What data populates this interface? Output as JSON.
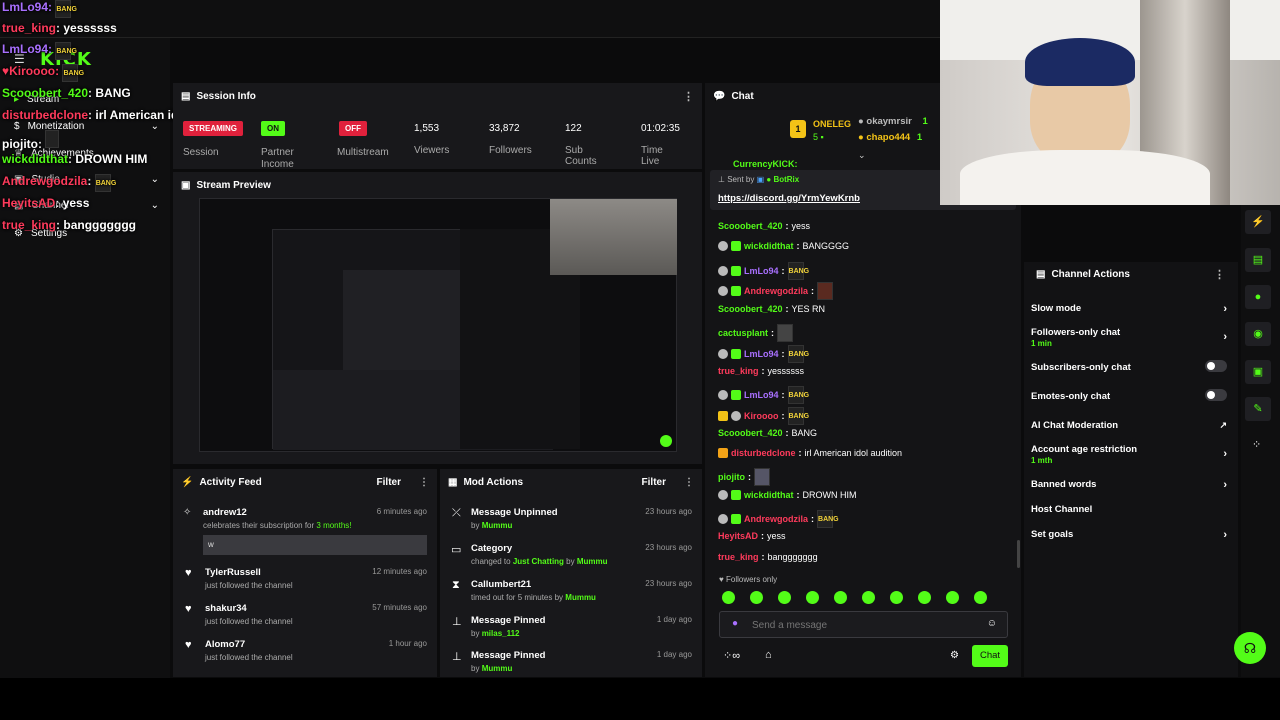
{
  "sidebar": {
    "items": [
      {
        "label": "Stream"
      },
      {
        "label": "Monetization"
      },
      {
        "label": "Achievements"
      },
      {
        "label": "Studio"
      },
      {
        "label": "Channel"
      },
      {
        "label": "Settings"
      }
    ]
  },
  "logo": "KICK",
  "overlay_chat": [
    {
      "user": "LmLo94",
      "msg": "",
      "color": "#a970ff"
    },
    {
      "user": "true_king",
      "msg": "yessssss",
      "color": "#ff3b5c"
    },
    {
      "user": "LmLo94",
      "msg": "",
      "color": "#a970ff"
    },
    {
      "user": "Kiroooo",
      "msg": "",
      "color": "#ff3b5c"
    },
    {
      "user": "Scooobert_420",
      "msg": "BANG",
      "color": "#53fc18"
    },
    {
      "user": "disturbedclone",
      "msg": "irl American idol audition",
      "color": "#ff3b5c"
    },
    {
      "user": "piojito",
      "msg": "",
      "color": "#ffffff"
    },
    {
      "user": "wickdidthat",
      "msg": "DROWN HIM",
      "color": "#53fc18"
    },
    {
      "user": "Andrewgodzila",
      "msg": "",
      "color": "#ff3b5c"
    },
    {
      "user": "HeyitsAD",
      "msg": "yess",
      "color": "#ff3b5c"
    },
    {
      "user": "true_king",
      "msg": "banggggggg",
      "color": "#ff3b5c"
    }
  ],
  "session": {
    "title": "Session Info",
    "streaming": "STREAMING",
    "on": "ON",
    "off": "OFF",
    "labels": {
      "session": "Session",
      "partner": "Partner Income",
      "multistream": "Multistream"
    },
    "stats": [
      {
        "value": "1,553",
        "label": "Viewers"
      },
      {
        "value": "33,872",
        "label": "Followers"
      },
      {
        "value": "122",
        "label": "Sub Counts"
      },
      {
        "value": "01:02:35",
        "label": "Time Live"
      }
    ]
  },
  "preview": {
    "title": "Stream Preview"
  },
  "activity": {
    "title": "Activity Feed",
    "filter": "Filter",
    "items": [
      {
        "user": "andrew12",
        "sub_prefix": "celebrates their subscription for ",
        "sub_count": "3 months!",
        "time": "6 minutes ago",
        "msg": "w"
      },
      {
        "user": "TylerRussell",
        "sub": "just followed the channel",
        "time": "12 minutes ago"
      },
      {
        "user": "shakur34",
        "sub": "just followed the channel",
        "time": "57 minutes ago"
      },
      {
        "user": "Alomo77",
        "sub": "just followed the channel",
        "time": "1 hour ago"
      }
    ]
  },
  "mod": {
    "title": "Mod Actions",
    "filter": "Filter",
    "items": [
      {
        "title": "Message Unpinned",
        "sub": "by",
        "who": "Mummu",
        "time": "23 hours ago"
      },
      {
        "title": "Category",
        "sub": "changed to",
        "cat": "Just Chatting",
        "by": "by",
        "who": "Mummu",
        "time": "23 hours ago"
      },
      {
        "title": "Callumbert21",
        "sub": "timed out for 5 minutes by",
        "who": "Mummu",
        "time": "23 hours ago"
      },
      {
        "title": "Message Pinned",
        "sub": "by",
        "who": "milas_112",
        "time": "1 day ago"
      },
      {
        "title": "Message Pinned",
        "sub": "by",
        "who": "Mummu",
        "time": "1 day ago"
      }
    ]
  },
  "chat": {
    "title": "Chat",
    "top_gifter": "ONELEG",
    "top_count": "5",
    "gifters": [
      {
        "name": "okaymrsir",
        "n": "1"
      },
      {
        "name": "chapo444",
        "n": "1"
      }
    ],
    "prev_user": "CurrencyKICK:",
    "pinned": {
      "sent_by": "Sent by",
      "bot": "BotRix",
      "link": "https://discord.gg/YrmYewKrnb"
    },
    "messages": [
      {
        "user": "Scooobert_420",
        "msg": "yess",
        "color": "#53fc18"
      },
      {
        "user": "wickdidthat",
        "msg": "BANGGGG",
        "color": "#53fc18"
      },
      {
        "user": "LmLo94",
        "msg": "",
        "color": "#a970ff"
      },
      {
        "user": "Andrewgodzila",
        "msg": "",
        "color": "#ff3b5c"
      },
      {
        "user": "Scooobert_420",
        "msg": "YES RN",
        "color": "#53fc18"
      },
      {
        "user": "cactusplant",
        "msg": "",
        "color": "#53fc18"
      },
      {
        "user": "LmLo94",
        "msg": "",
        "color": "#a970ff"
      },
      {
        "user": "true_king",
        "msg": "yessssss",
        "color": "#ff3b5c"
      },
      {
        "user": "LmLo94",
        "msg": "",
        "color": "#a970ff"
      },
      {
        "user": "Kiroooo",
        "msg": "",
        "color": "#ff3b5c"
      },
      {
        "user": "Scooobert_420",
        "msg": "BANG",
        "color": "#53fc18"
      },
      {
        "user": "disturbedclone",
        "msg": "irl American idol audition",
        "color": "#ff3b5c"
      },
      {
        "user": "piojito",
        "msg": "",
        "color": "#53fc18"
      },
      {
        "user": "wickdidthat",
        "msg": "DROWN HIM",
        "color": "#53fc18"
      },
      {
        "user": "Andrewgodzila",
        "msg": "",
        "color": "#ff3b5c"
      },
      {
        "user": "HeyitsAD",
        "msg": "yess",
        "color": "#ff3b5c"
      },
      {
        "user": "true_king",
        "msg": "banggggggg",
        "color": "#ff3b5c"
      }
    ],
    "mode": "Followers only",
    "placeholder": "Send a message",
    "send": "Chat"
  },
  "channel_actions": {
    "title": "Channel Actions",
    "items": [
      {
        "label": "Slow mode",
        "sub": "",
        "control": "chevron"
      },
      {
        "label": "Followers-only chat",
        "sub": "1 min",
        "control": "chevron"
      },
      {
        "label": "Subscribers-only chat",
        "sub": "",
        "control": "toggle"
      },
      {
        "label": "Emotes-only chat",
        "sub": "",
        "control": "toggle"
      },
      {
        "label": "AI Chat Moderation",
        "sub": "",
        "control": "external"
      },
      {
        "label": "Account age restriction",
        "sub": "1 mth",
        "control": "chevron"
      },
      {
        "label": "Banned words",
        "sub": "",
        "control": "chevron"
      },
      {
        "label": "Host Channel",
        "sub": "",
        "control": "none"
      },
      {
        "label": "Set goals",
        "sub": "",
        "control": "chevron"
      }
    ]
  },
  "colors": {
    "accent": "#53fc18",
    "panel": "#18181b",
    "bg": "#0b0b0c",
    "live": "#e0213c"
  },
  "emote_label": "BANG"
}
